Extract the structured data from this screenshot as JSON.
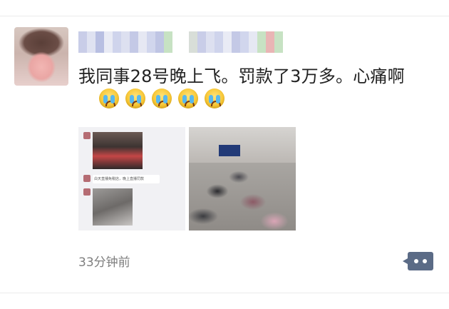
{
  "post": {
    "text": "我同事28号晚上飞。罚款了3万多。心痛啊",
    "emoji": [
      "crying-face",
      "crying-face",
      "crying-face",
      "crying-face",
      "crying-face"
    ],
    "images": [
      {
        "caption": "白天直播免税店，晚上直播罚款"
      },
      {
        "caption": ""
      }
    ],
    "timestamp": "33分钟前"
  },
  "colors": {
    "text": "#222222",
    "timestamp": "#7e7e7e",
    "action_button": "#5b6b86"
  }
}
